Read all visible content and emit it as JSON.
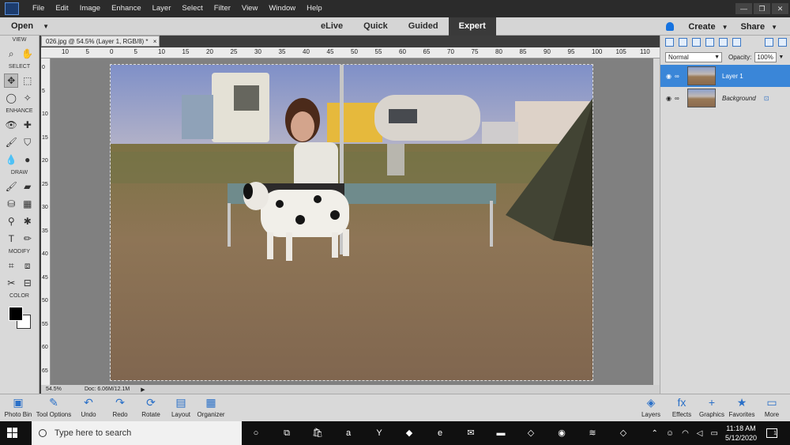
{
  "menu": [
    "File",
    "Edit",
    "Image",
    "Enhance",
    "Layer",
    "Select",
    "Filter",
    "View",
    "Window",
    "Help"
  ],
  "window_controls": {
    "minimize": "—",
    "restore": "❐",
    "close": "✕"
  },
  "modebar": {
    "open_label": "Open",
    "modes": [
      "eLive",
      "Quick",
      "Guided",
      "Expert"
    ],
    "active_mode": "Expert",
    "create_label": "Create",
    "share_label": "Share"
  },
  "toolbox": {
    "sections": {
      "view": "VIEW",
      "select": "SELECT",
      "enhance": "ENHANCE",
      "draw": "DRAW",
      "modify": "MODIFY",
      "color": "COLOR"
    },
    "foreground_color": "#000000",
    "background_color": "#ffffff"
  },
  "document": {
    "tab_title": "026.jpg @ 54.5% (Layer 1, RGB/8) *",
    "tab_close": "×",
    "ruler_h": [
      "10",
      "5",
      "0",
      "5",
      "10",
      "15",
      "20",
      "25",
      "30",
      "35",
      "40",
      "45",
      "50",
      "55",
      "60",
      "65",
      "70",
      "75",
      "80",
      "85",
      "90",
      "95",
      "100",
      "105",
      "110"
    ],
    "ruler_v": [
      "0",
      "5",
      "10",
      "15",
      "20",
      "25",
      "30",
      "35",
      "40",
      "45",
      "50",
      "55",
      "60",
      "65"
    ],
    "zoom": "54.5%",
    "doc_size": "Doc: 6.06M/12.1M"
  },
  "layers_panel": {
    "blend_mode": "Normal",
    "opacity_label": "Opacity:",
    "opacity_value": "100%",
    "layers": [
      {
        "name": "Layer 1",
        "active": true,
        "italic": false
      },
      {
        "name": "Background",
        "active": false,
        "italic": true
      }
    ]
  },
  "bottom_left": [
    {
      "label": "Photo Bin",
      "icon": "photo-bin-icon",
      "glyph": "▣"
    },
    {
      "label": "Tool Options",
      "icon": "tool-options-icon",
      "glyph": "✎"
    },
    {
      "label": "Undo",
      "icon": "undo-icon",
      "glyph": "↶"
    },
    {
      "label": "Redo",
      "icon": "redo-icon",
      "glyph": "↷"
    },
    {
      "label": "Rotate",
      "icon": "rotate-icon",
      "glyph": "⟳"
    },
    {
      "label": "Layout",
      "icon": "layout-icon",
      "glyph": "▤"
    },
    {
      "label": "Organizer",
      "icon": "organizer-icon",
      "glyph": "▦"
    }
  ],
  "bottom_right": [
    {
      "label": "Layers",
      "icon": "layers-icon",
      "glyph": "◈"
    },
    {
      "label": "Effects",
      "icon": "effects-icon",
      "glyph": "fx"
    },
    {
      "label": "Graphics",
      "icon": "graphics-icon",
      "glyph": "+"
    },
    {
      "label": "Favorites",
      "icon": "favorites-icon",
      "glyph": "★"
    },
    {
      "label": "More",
      "icon": "more-icon",
      "glyph": "▭"
    }
  ],
  "taskbar": {
    "search_placeholder": "Type here to search",
    "time": "11:18 AM",
    "date": "5/12/2020",
    "notifications": "1",
    "apps": [
      {
        "name": "cortana-icon",
        "glyph": "○"
      },
      {
        "name": "task-view-icon",
        "glyph": "⧉"
      },
      {
        "name": "store-icon",
        "glyph": "🛍"
      },
      {
        "name": "amazon-icon",
        "glyph": "a"
      },
      {
        "name": "yahoo-icon",
        "glyph": "Y"
      },
      {
        "name": "dropbox-icon",
        "glyph": "◆"
      },
      {
        "name": "edge-icon",
        "glyph": "e"
      },
      {
        "name": "mail-icon",
        "glyph": "✉"
      },
      {
        "name": "explorer-icon",
        "glyph": "▬"
      },
      {
        "name": "elements-icon",
        "glyph": "◇"
      },
      {
        "name": "chrome-icon",
        "glyph": "◉"
      },
      {
        "name": "app-icon",
        "glyph": "≋"
      },
      {
        "name": "elements-editor-icon",
        "glyph": "◇"
      }
    ]
  },
  "colors": {
    "accent": "#3a86d8",
    "mode_active": "#3a3a3a",
    "taskbar": "#101010"
  }
}
